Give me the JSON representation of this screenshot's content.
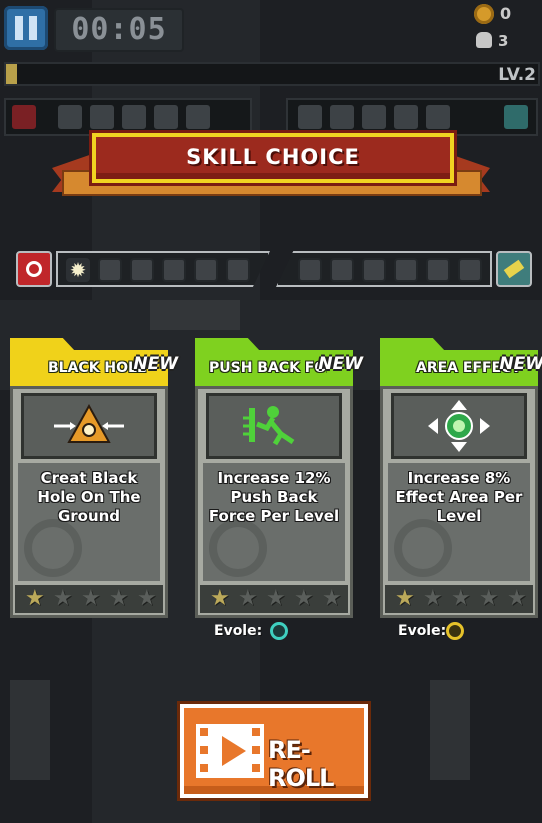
{
  "hud": {
    "timer": "00:05",
    "coins": "0",
    "kills": "3",
    "level": "LV.2",
    "xp_progress": 0.02
  },
  "banner": {
    "title": "SKILL CHOICE"
  },
  "skill_bar": {
    "left_icon": "crosshair-skill-icon",
    "right_icon": "battery-skill-icon",
    "equipped_glyph": "✹"
  },
  "cards": [
    {
      "title": "BLACK HOLE",
      "badge": "NEW",
      "description": "Creat Black Hole On The Ground",
      "icon": "black-hole-pyramid-icon",
      "header_color": "#f0d21a",
      "stars_filled": 1,
      "stars_total": 5,
      "evolve_label": ""
    },
    {
      "title": "PUSH BACK FORCE",
      "badge": "NEW",
      "description": "Increase 12% Push Back Force Per Level",
      "icon": "push-back-figure-icon",
      "header_color": "#7fd11f",
      "stars_filled": 1,
      "stars_total": 5,
      "evolve_label": "Evole:"
    },
    {
      "title": "AREA EFFECT",
      "badge": "NEW",
      "description": "Increase 8% Effect Area Per Level",
      "icon": "area-effect-icon",
      "header_color": "#7fd11f",
      "stars_filled": 1,
      "stars_total": 5,
      "evolve_label": "Evole:"
    }
  ],
  "reroll": {
    "label": "RE-ROLL"
  }
}
